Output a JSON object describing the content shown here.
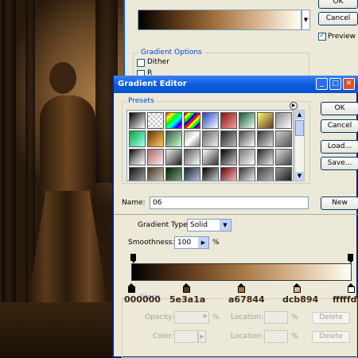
{
  "gradient_fill_dialog": {
    "ok_label": "OK",
    "cancel_label": "Cancel",
    "preview_label": "Preview",
    "preview_checked": true,
    "options_legend": "Gradient Options",
    "dither_label": "Dither",
    "second_option_partial": "R"
  },
  "gradient_editor": {
    "title": "Gradient Editor",
    "presets_legend": "Presets",
    "ok_label": "OK",
    "cancel_label": "Cancel",
    "load_label": "Load...",
    "save_label": "Save...",
    "name_label": "Name:",
    "name_value": "06",
    "new_label": "New",
    "gradient_type_label": "Gradient Type:",
    "gradient_type_value": "Solid",
    "smoothness_label": "Smoothness:",
    "smoothness_value": "100",
    "smoothness_unit": "%",
    "stops": {
      "legend": "Stops",
      "opacity_label": "Opacity:",
      "location_label": "Location:",
      "percent": "%",
      "delete_label": "Delete",
      "color_label": "Color:"
    },
    "color_stops": [
      {
        "label": "000000",
        "color": "#000000",
        "location": 0
      },
      {
        "label": "5e3a1a",
        "color": "#5e3a1a",
        "location": 25
      },
      {
        "label": "a67844",
        "color": "#a67844",
        "location": 50
      },
      {
        "label": "dcb894",
        "color": "#dcb894",
        "location": 75
      },
      {
        "label": "fffffd",
        "color": "#fffff5",
        "location": 100
      }
    ]
  }
}
